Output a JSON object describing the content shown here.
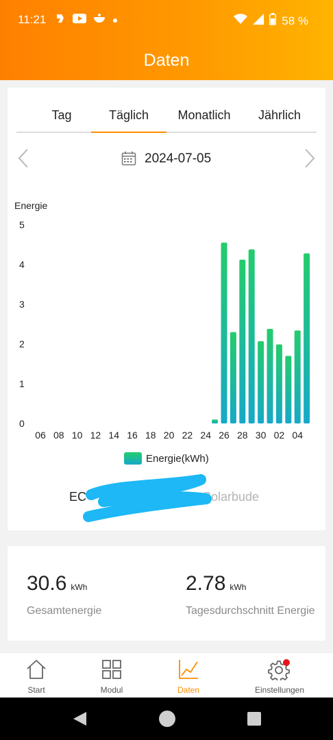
{
  "status": {
    "time": "11:21",
    "battery": "58 %"
  },
  "header": {
    "title": "Daten"
  },
  "tabs": [
    {
      "label": "Tag"
    },
    {
      "label": "Täglich",
      "active": true
    },
    {
      "label": "Monatlich"
    },
    {
      "label": "Jährlich"
    }
  ],
  "date": {
    "value": "2024-07-05"
  },
  "chart_data": {
    "type": "bar",
    "ylabel": "Energie",
    "ylim": [
      0,
      5
    ],
    "yticks": [
      "0",
      "1",
      "2",
      "3",
      "4",
      "5"
    ],
    "xtick_labels": [
      "06",
      "08",
      "10",
      "12",
      "14",
      "16",
      "18",
      "20",
      "22",
      "24",
      "26",
      "28",
      "30",
      "02",
      "04"
    ],
    "categories": [
      "06",
      "07",
      "08",
      "09",
      "10",
      "11",
      "12",
      "13",
      "14",
      "15",
      "16",
      "17",
      "18",
      "19",
      "20",
      "21",
      "22",
      "23",
      "24",
      "25",
      "26",
      "27",
      "28",
      "29",
      "30",
      "01",
      "02",
      "03",
      "04",
      "05"
    ],
    "series": [
      {
        "name": "Energie(kWh)",
        "values": [
          0,
          0,
          0,
          0,
          0,
          0,
          0,
          0,
          0,
          0,
          0,
          0,
          0,
          0,
          0,
          0,
          0,
          0,
          0,
          0.1,
          4.55,
          2.3,
          4.12,
          4.38,
          2.07,
          2.38,
          1.99,
          1.7,
          2.34,
          4.28
        ]
      }
    ],
    "colors": {
      "top": "#24cc6c",
      "bottom": "#17a9c8"
    },
    "legend": "bottom-center"
  },
  "legend": {
    "label": "Energie(kWh)"
  },
  "device": {
    "left": "EC",
    "right": "Solarbude"
  },
  "stats": {
    "total": {
      "value": "30.6",
      "unit": "kWh",
      "label": "Gesamtenergie"
    },
    "average": {
      "value": "2.78",
      "unit": "kWh",
      "label": "Tagesdurchschnitt Energie"
    }
  },
  "nav": [
    {
      "label": "Start",
      "icon": "home-icon"
    },
    {
      "label": "Modul",
      "icon": "grid-icon"
    },
    {
      "label": "Daten",
      "icon": "chart-icon",
      "active": true
    },
    {
      "label": "Einstellungen",
      "icon": "gear-icon",
      "badge": true
    }
  ]
}
